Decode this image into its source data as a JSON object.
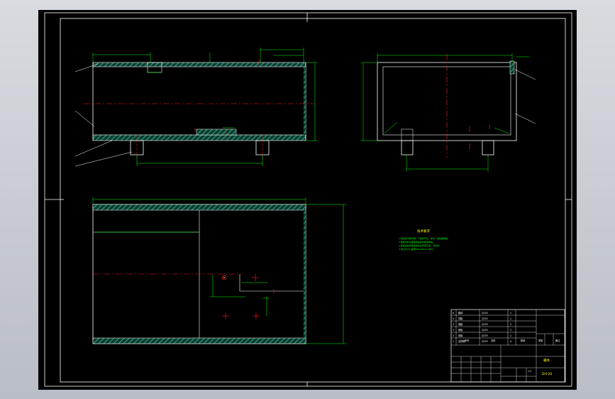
{
  "drawing": {
    "technical_requirements": {
      "heading": "技术要求",
      "lines": [
        "1.焊缝应平整光滑，不得有气孔、夹渣、裂纹等缺陷。",
        "2.箱体内外表面除锈后涂防锈漆两遍。",
        "3.装配后检查各连接处应牢固可靠，无松动。",
        "4.未注尺寸公差按GB/T1804-m执行。"
      ]
    },
    "title_block": {
      "drawing_name": "箱体",
      "drawing_number": "DH-20",
      "scale": "1:2",
      "labels": {
        "seq": "序号",
        "name": "名称",
        "qty": "数量",
        "material": "材料",
        "weight": "重量",
        "remark": "备注"
      },
      "parts": [
        {
          "no": "1",
          "name": "支撑脚",
          "material": "Q235",
          "qty": "4"
        },
        {
          "no": "2",
          "name": "底板",
          "material": "Q235",
          "qty": "1"
        },
        {
          "no": "3",
          "name": "侧板",
          "material": "Q235",
          "qty": "2"
        },
        {
          "no": "4",
          "name": "端板",
          "material": "Q235",
          "qty": "2"
        },
        {
          "no": "5",
          "name": "顶板",
          "material": "Q235",
          "qty": "1"
        },
        {
          "no": "6",
          "name": "箱体",
          "material": "Q235",
          "qty": "1"
        }
      ]
    }
  }
}
